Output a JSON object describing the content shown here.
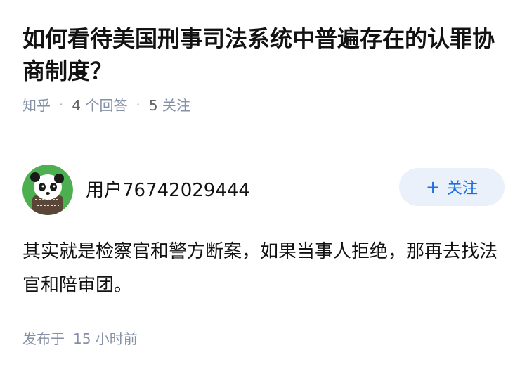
{
  "question": {
    "title": "如何看待美国刑事司法系统中普遍存在的认罪协商制度？",
    "source": "知乎",
    "answers_count": "4",
    "answers_label": "个回答",
    "followers_count": "5",
    "followers_label": "关注"
  },
  "answer": {
    "author_name": "用户76742029444",
    "avatar_icon": "panda-avatar-icon",
    "follow_icon": "plus-icon",
    "follow_plus": "+",
    "follow_label": "关注",
    "content": "其实就是检察官和警方断案，如果当事人拒绝，那再去找法官和陪审团。",
    "published_prefix": "发布于",
    "published_time": "15 小时前"
  },
  "colors": {
    "accent": "#1d6ee0",
    "follow_bg": "#eaf1fb",
    "meta_text": "#8590a6",
    "avatar_bg": "#4caf50"
  }
}
